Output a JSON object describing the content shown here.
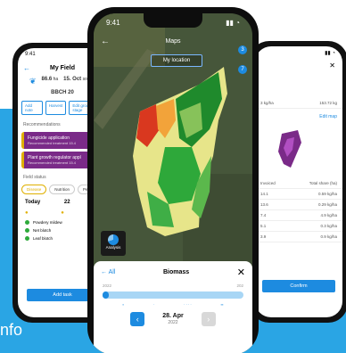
{
  "caption": "nfo",
  "colors": {
    "band": "#2aa5e4",
    "accent": "#1d8be0",
    "purple": "#7a2a88"
  },
  "left": {
    "time": "9:41",
    "title": "My Field",
    "stat1_value": "86.6",
    "stat1_label": "ha",
    "stat2_value": "15. Oct",
    "stat2_label": "sowed",
    "crop_label": "BBCH 20",
    "actions": [
      "Add note",
      "Harvest",
      "Edit growth stage"
    ],
    "recommend_title": "Recommendations",
    "cards": [
      {
        "title": "Fungicide application",
        "sub": "Recommended treatment 15.4"
      },
      {
        "title": "Plant growth regulator appl",
        "sub": "Recommended treatment 15.4"
      }
    ],
    "status_title": "Field status",
    "segments": [
      "Disease",
      "Nutrition",
      "Pests"
    ],
    "days": [
      "Today",
      "22",
      "23"
    ],
    "legend": [
      {
        "label": "Powdery mildew",
        "color": "#2eaa3b"
      },
      {
        "label": "Net blotch",
        "color": "#2eaa3b"
      },
      {
        "label": "Leaf blotch",
        "color": "#2eaa3b"
      }
    ],
    "button": "Add task"
  },
  "center": {
    "time": "9:41",
    "map_title": "Maps",
    "location_button": "My location",
    "badges": [
      "3",
      "7"
    ],
    "analysis_label": "Analysis",
    "sheet_all": "All",
    "sheet_title": "Biomass",
    "year_left": "2022",
    "year_right": "202",
    "date_day": "28. Apr",
    "date_year": "2022"
  },
  "right": {
    "rows": [
      [
        "3 kg/ha",
        "153.72 kg"
      ],
      [
        "Edit map",
        ""
      ],
      [
        "Invoiced",
        "Total share (ha)"
      ],
      [
        "14.1",
        "0.59 kg/ha"
      ],
      [
        "13.6",
        "0.29 kg/ha"
      ],
      [
        "7.4",
        "4.9 kg/ha"
      ],
      [
        "5.1",
        "0.3 kg/ha"
      ],
      [
        "3.9",
        "0.9 kg/ha"
      ]
    ],
    "button": "Confirm"
  }
}
